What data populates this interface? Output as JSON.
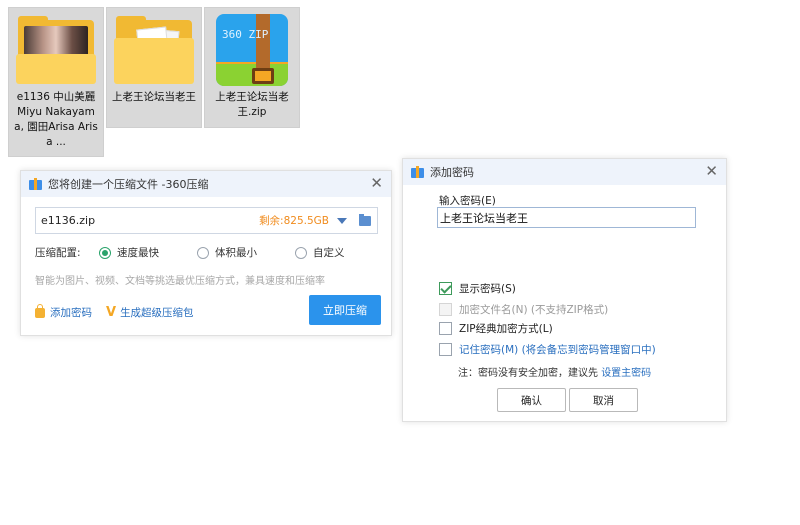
{
  "desktop": {
    "items": [
      {
        "name": "e1136 中山美麗 Miyu Nakayama, 園田Arisa Arisa ...",
        "type": "photo-folder"
      },
      {
        "name": "上老王论坛当老王",
        "type": "folder"
      },
      {
        "name": "上老王论坛当老王.zip",
        "type": "zip",
        "zip_label": "360 ZIP"
      }
    ]
  },
  "compress_dialog": {
    "title": "您将创建一个压缩文件 -360压缩",
    "filename": "e1136.zip",
    "free_space": "剩余:825.5GB",
    "config_label": "压缩配置:",
    "options": [
      "速度最快",
      "体积最小",
      "自定义"
    ],
    "selected_option": "速度最快",
    "hint": "智能为图片、视频、文档等挑选最优压缩方式，兼具速度和压缩率",
    "add_password": "添加密码",
    "super_archive": "生成超级压缩包",
    "compress_now": "立即压缩",
    "close_symbol": "✕"
  },
  "password_dialog": {
    "title": "添加密码",
    "input_label": "输入密码(E)",
    "password_value": "上老王论坛当老王",
    "show_password": "显示密码(S)",
    "show_password_checked": true,
    "encrypt_filenames": "加密文件名(N) (不支持ZIP格式)",
    "zip_classic": "ZIP经典加密方式(L)",
    "remember_password": "记住密码(M) (将会备忘到密码管理窗口中)",
    "note_prefix": "注：密码没有安全加密，建议先",
    "note_link": "设置主密码",
    "ok": "确认",
    "cancel": "取消",
    "close_symbol": "✕"
  },
  "colors": {
    "accent_blue": "#2b93ec",
    "link_blue": "#2a6fbf",
    "orange": "#f08b1d",
    "green_check": "#3e9a5b"
  }
}
